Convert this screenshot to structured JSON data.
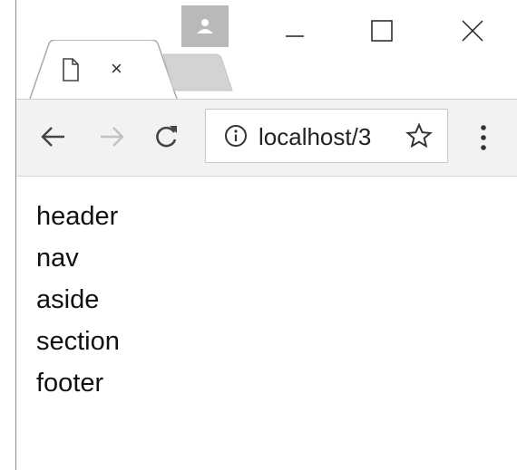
{
  "browser": {
    "tab": {
      "close_glyph": "×",
      "icon": "document-icon"
    },
    "window_controls": {
      "minimize_icon": "minimize-icon",
      "maximize_icon": "maximize-icon",
      "close_icon": "close-icon"
    },
    "toolbar": {
      "back_icon": "arrow-left-icon",
      "forward_icon": "arrow-right-icon",
      "reload_icon": "reload-icon",
      "address": "localhost/3",
      "info_icon": "info-icon",
      "bookmark_icon": "star-icon",
      "menu_icon": "kebab-menu-icon"
    },
    "colors": {
      "toolbar_bg": "#f2f2f2",
      "avatar_badge": "#b9b9b9",
      "window_edge": "#5b9bd5"
    }
  },
  "page": {
    "lines": [
      "header",
      "nav",
      "aside",
      "section",
      "footer"
    ]
  }
}
